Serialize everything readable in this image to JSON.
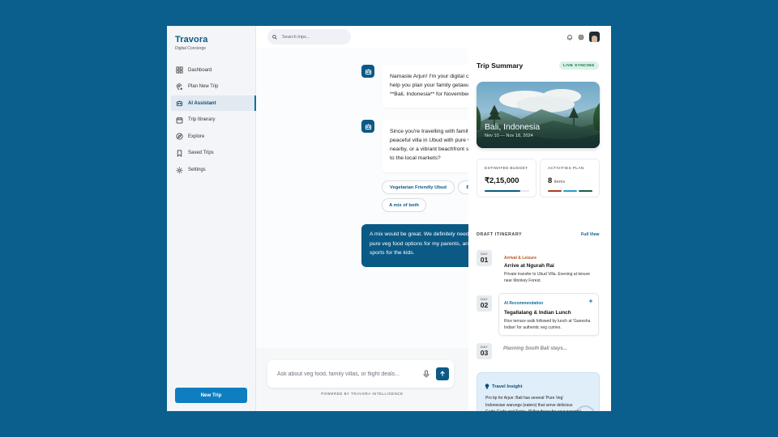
{
  "brand": {
    "title": "Travora",
    "subtitle": "Digital Concierge"
  },
  "sidebar": {
    "items": [
      {
        "label": "Dashboard",
        "icon": "dashboard-icon"
      },
      {
        "label": "Plan New Trip",
        "icon": "map-pin-plus-icon"
      },
      {
        "label": "AI Assistant",
        "icon": "robot-icon",
        "active": true
      },
      {
        "label": "Trip Itinerary",
        "icon": "calendar-icon"
      },
      {
        "label": "Explore",
        "icon": "compass-icon"
      },
      {
        "label": "Saved Trips",
        "icon": "bookmark-icon"
      },
      {
        "label": "Settings",
        "icon": "gear-icon"
      }
    ],
    "new_trip_label": "New Trip"
  },
  "search": {
    "placeholder": "Search trips..."
  },
  "chat": {
    "messages": [
      {
        "from": "assistant",
        "text": "Namaste Arjun! I'm your digital concierge. I'm excited to help you plan your family getaway. I see we're looking at **Bali, Indonesia** for November."
      },
      {
        "from": "assistant",
        "text": "Since you're travelling with family, would you prefer a peaceful villa in Ubud with pure vegetarian options nearby, or a vibrant beachfront stay in Seminyak closer to the local markets?"
      },
      {
        "from": "user",
        "text": "A mix would be great. We definitely need good Indian or pure veg food options for my parents, and some water sports for the kids."
      }
    ],
    "chips": [
      "Vegetarian Friendly Ubud",
      "Beachfront Seminyak",
      "A mix of both"
    ]
  },
  "composer": {
    "placeholder": "Ask about veg food, family villas, or flight deals...",
    "powered_by": "POWERED BY TRAVORA INTELLIGENCE"
  },
  "trip_summary": {
    "title": "Trip Summary",
    "status": "LIVE SYNCING",
    "destination": "Bali, Indonesia",
    "dates": "Nov 10 — Nov 18, 2024",
    "budget_label": "ESTIMATED BUDGET",
    "budget_value": "₹2,15,000",
    "budget_progress": 0.8,
    "activities_label": "ACTIVITIES PLAN",
    "activities_count": "8",
    "activities_unit": "items"
  },
  "itinerary": {
    "label": "DRAFT ITINERARY",
    "full_view": "Full View",
    "days": [
      {
        "day_label": "DAY",
        "num": "01",
        "tag": "Arrival & Leisure",
        "tag_color": "#b2541a",
        "title": "Arrive at Ngurah Rai",
        "desc": "Private transfer to Ubud Villa. Evening at leisure near Monkey Forest."
      },
      {
        "day_label": "DAY",
        "num": "02",
        "tag": "AI Recommendation",
        "tag_color": "#0b6fa4",
        "title": "Tegallalang & Indian Lunch",
        "desc": "Rice terrace walk followed by lunch at 'Ganesha Indian' for authentic veg curries."
      },
      {
        "day_label": "DAY",
        "num": "03",
        "planning": "Planning South Bali stays..."
      }
    ]
  },
  "insight": {
    "title": "Travel Insight",
    "text": "Pro tip for Arjun: Bali has several 'Pure Veg' Indonesian warungs (eaters) that serve delicious Gado-Gado and Satay. I'll flag these for your parents!"
  },
  "colors": {
    "brand": "#0b5a86",
    "accent": "#0e7ec0",
    "background": "#0a5f8c"
  }
}
